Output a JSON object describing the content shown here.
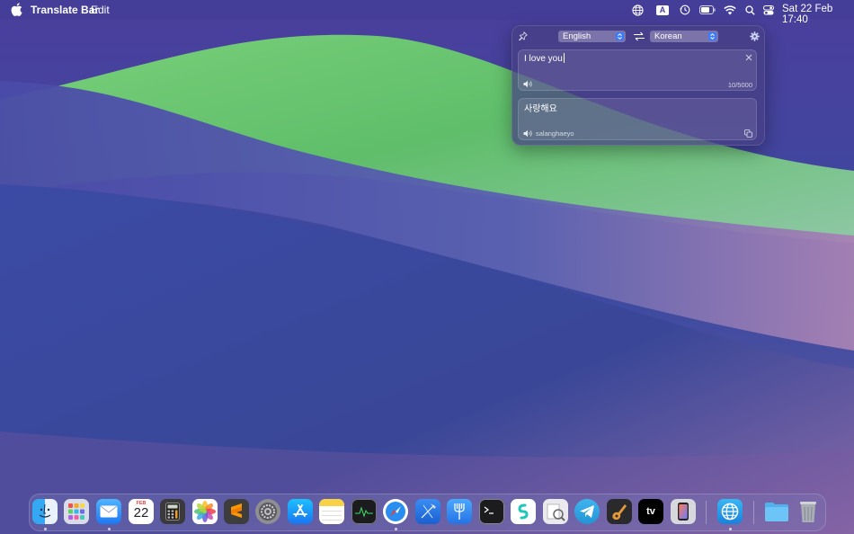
{
  "menubar": {
    "app_name": "Translate Bar",
    "menus": [
      "Edit"
    ],
    "status_icons": [
      "translate-globe-icon",
      "input-source-icon",
      "time-machine-icon",
      "battery-icon",
      "wifi-icon",
      "spotlight-search-icon",
      "control-center-icon"
    ],
    "input_source_letter": "A",
    "clock": "Sat 22 Feb  17:40"
  },
  "popover": {
    "source_language": "English",
    "target_language": "Korean",
    "input_text": "I love you",
    "char_count": "10/5000",
    "translated_text": "사랑해요",
    "romanization": "salanghaeyo"
  },
  "dock": {
    "calendar_month": "FEB",
    "calendar_day": "22",
    "appletv_label": "tv",
    "apps": [
      "Finder",
      "Launchpad",
      "Mail",
      "Calendar",
      "Calculator",
      "Photos",
      "Sublime Text",
      "System Settings",
      "App Store",
      "Notes",
      "Activity Monitor",
      "Safari",
      "Xcode",
      "Fork",
      "Terminal",
      "Surfshark",
      "Preview",
      "Telegram",
      "GarageBand",
      "Apple TV",
      "Simulator",
      "Translate Bar",
      "Downloads",
      "Trash"
    ]
  },
  "colors": {
    "accent": "#3a7bff",
    "wallpaper_green": "#6cc46a",
    "wallpaper_purple": "#5a4aa8",
    "wallpaper_blue": "#3c4aa0"
  }
}
